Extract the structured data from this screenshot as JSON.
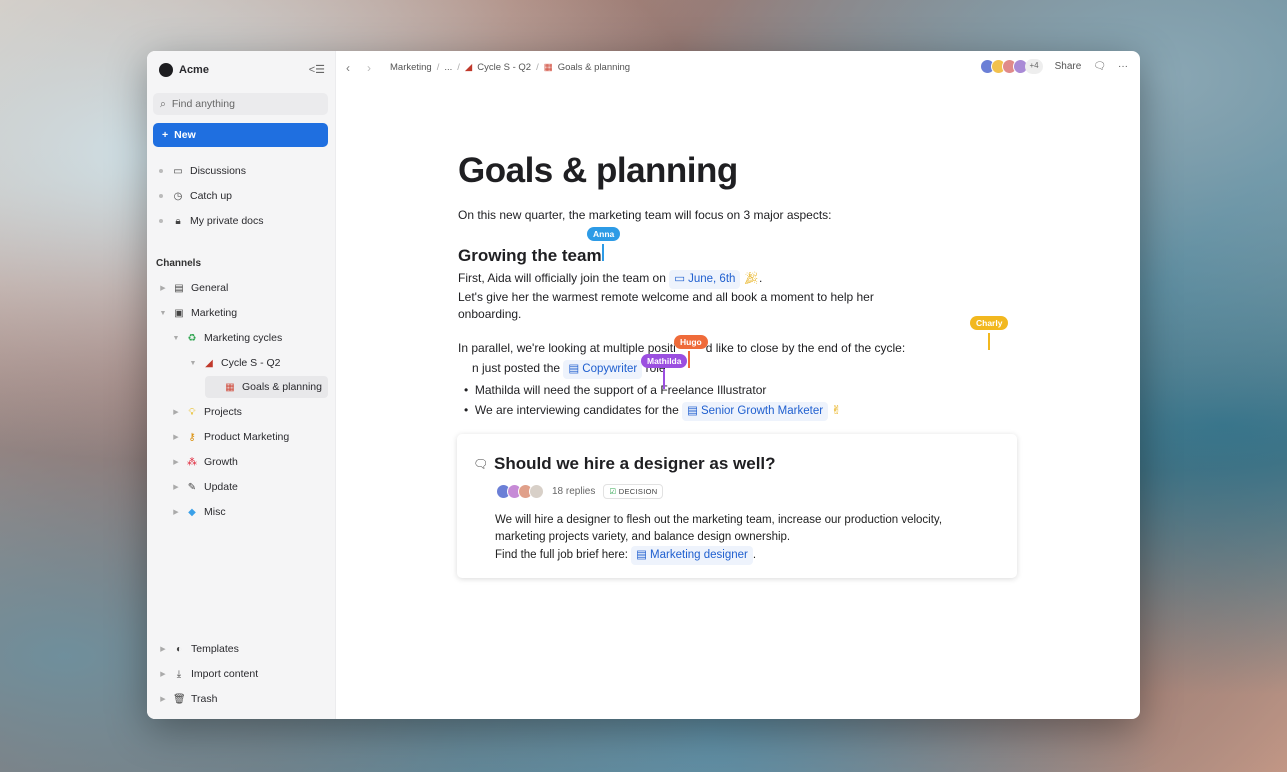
{
  "workspace": {
    "name": "Acme"
  },
  "sidebar": {
    "search_placeholder": "Find anything",
    "new_label": "New",
    "top_items": [
      {
        "label": "Discussions",
        "icon": "chat-icon"
      },
      {
        "label": "Catch up",
        "icon": "clock-icon"
      },
      {
        "label": "My private docs",
        "icon": "lock-icon"
      }
    ],
    "channels_heading": "Channels",
    "channels": [
      {
        "label": "General"
      },
      {
        "label": "Marketing"
      },
      {
        "label": "Marketing cycles"
      },
      {
        "label": "Cycle S - Q2"
      },
      {
        "label": "Goals & planning"
      },
      {
        "label": "Projects"
      },
      {
        "label": "Product Marketing"
      },
      {
        "label": "Growth"
      },
      {
        "label": "Update"
      },
      {
        "label": "Misc"
      }
    ],
    "bottom_items": [
      {
        "label": "Templates"
      },
      {
        "label": "Import content"
      },
      {
        "label": "Trash"
      }
    ]
  },
  "topbar": {
    "breadcrumbs": [
      "Marketing",
      "...",
      "Cycle S - Q2",
      "Goals & planning"
    ],
    "extra_avatars": "+4",
    "share_label": "Share"
  },
  "doc": {
    "title": "Goals & planning",
    "intro": "On this new quarter, the marketing team will focus on 3 major aspects:",
    "h2": "Growing the team",
    "p1a": "First, Aida will officially join the team on",
    "date_chip": "June, 6th",
    "p1b": "Let's give her the warmest remote welcome and all book a moment to help her onboarding.",
    "p2": "In parallel, we're looking at multiple positi",
    "p2b": "d like to close by the end of the cycle:",
    "p3a": "n just posted the",
    "copywriter": "Copywriter",
    "p3b": "role",
    "bullet1": "Mathilda will need the support of a Freelance Illustrator",
    "bullet2a": "We are interviewing candidates for the",
    "senior": "Senior Growth Marketer"
  },
  "cursors": {
    "anna": "Anna",
    "hugo": "Hugo",
    "charly": "Charly",
    "mathilda": "Mathilda"
  },
  "card": {
    "title": "Should we hire a designer as well?",
    "replies": "18 replies",
    "badge": "DECISION",
    "body1": "We will hire a designer to flesh out the marketing team, increase our production velocity,",
    "body2": "marketing projects variety, and balance design ownership.",
    "body3": "Find the full job brief here:",
    "link": "Marketing designer",
    "dot": "."
  },
  "colors": {
    "accent": "#1f6fe0",
    "anna": "#2d9be6",
    "hugo": "#ef6b3a",
    "charly": "#f2b81f",
    "mathilda": "#9b4fe0"
  }
}
